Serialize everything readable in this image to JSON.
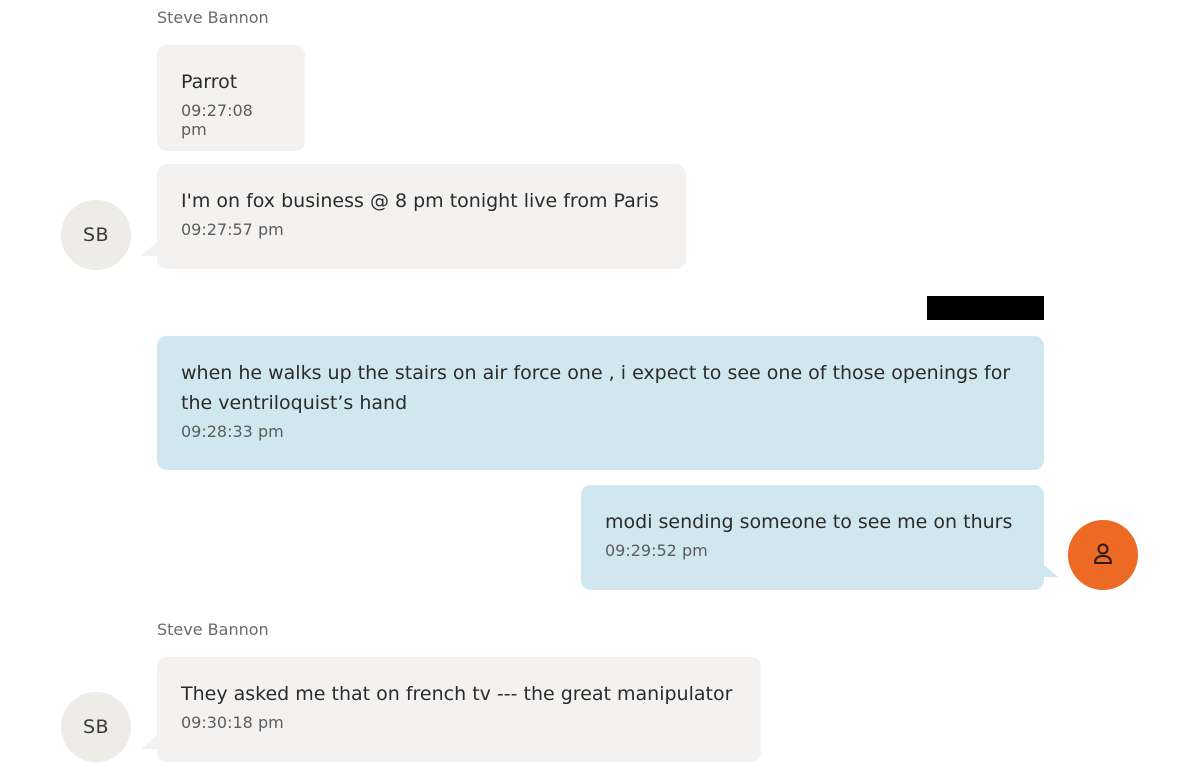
{
  "colors": {
    "incoming_bubble": "#f3f2f1",
    "outgoing_bubble": "#d0e7f0",
    "sender_avatar_bg": "#edece6",
    "user_avatar_bg": "#ec6a24"
  },
  "conversation": {
    "sender_name_1": "Steve Bannon",
    "sender_name_2": "Steve Bannon",
    "sender_avatar_initials": "SB",
    "user_avatar_icon": "person-icon",
    "messages": [
      {
        "direction": "incoming",
        "text": "Parrot",
        "time": "09:27:08 pm"
      },
      {
        "direction": "incoming",
        "text": "I'm on fox business @ 8 pm tonight live from Paris",
        "time": "09:27:57 pm"
      },
      {
        "direction": "outgoing",
        "text": "when he walks up the stairs on air force one , i expect to see one of those openings for the ventriloquist’s hand",
        "time": "09:28:33 pm"
      },
      {
        "direction": "outgoing",
        "text": "modi sending someone to see me on thurs",
        "time": "09:29:52 pm"
      },
      {
        "direction": "incoming",
        "text": "They asked me that on french tv --- the great manipulator",
        "time": "09:30:18 pm"
      }
    ]
  }
}
